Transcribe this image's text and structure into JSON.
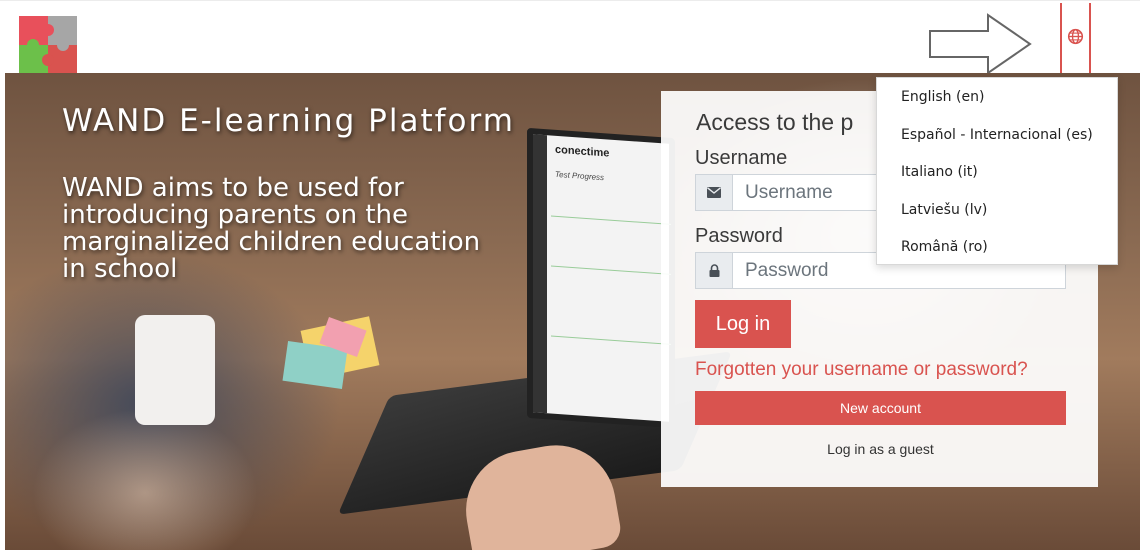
{
  "navbar": {
    "logo_icon": "puzzle-logo-icon",
    "language_icon": "globe-icon",
    "annotation_icon": "arrow-right-outline-icon",
    "accent_color": "#d9534f"
  },
  "hero": {
    "title": "WAND E-learning Platform",
    "description": "WAND aims to be used for introducing parents on the marginalized children education in school",
    "screen_brand": "conectime",
    "screen_heading": "Test Progress"
  },
  "login": {
    "heading": "Access to the p",
    "username_label": "Username",
    "username_placeholder": "Username",
    "username_icon": "envelope-icon",
    "password_label": "Password",
    "password_placeholder": "Password",
    "password_icon": "lock-icon",
    "login_button": "Log in",
    "forgot_link": "Forgotten your username or password?",
    "new_account_button": "New account",
    "guest_link": "Log in as a guest"
  },
  "language_menu": {
    "items": [
      "English (en)",
      "Español - Internacional (es)",
      "Italiano (it)",
      "Latviešu (lv)",
      "Română (ro)"
    ]
  }
}
